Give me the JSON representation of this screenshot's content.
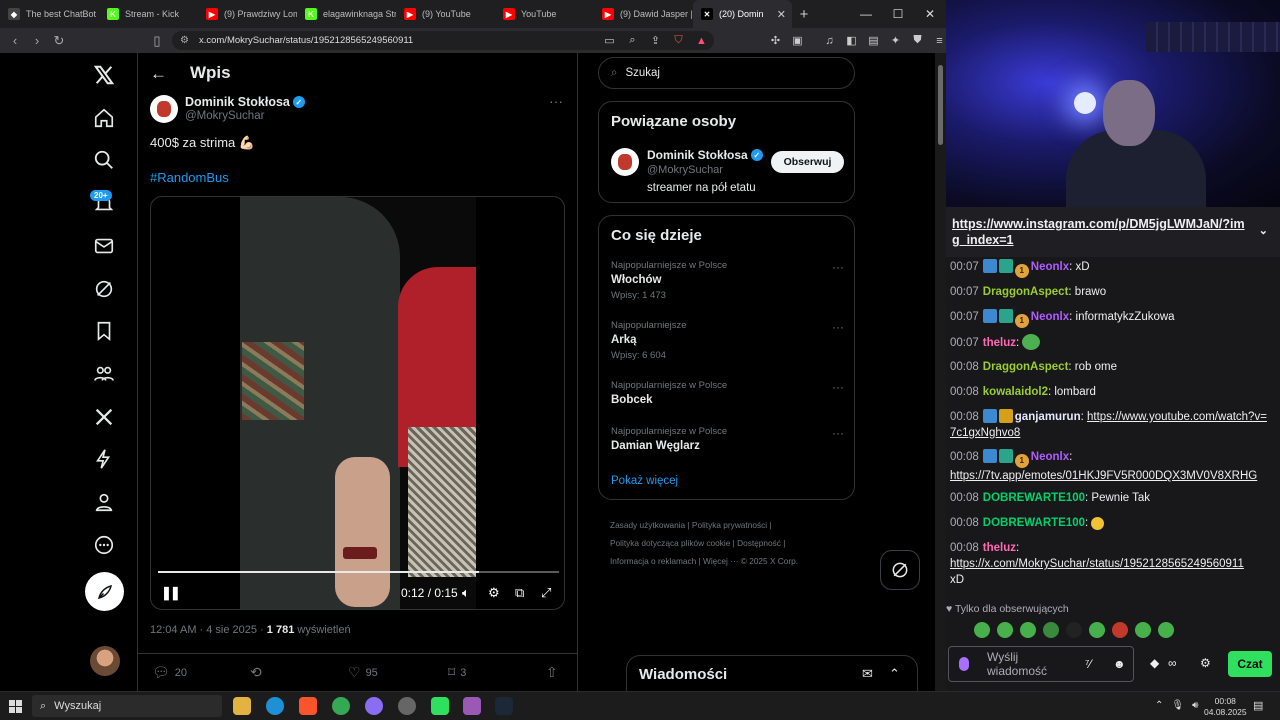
{
  "browser": {
    "tabs": [
      {
        "label": "The best ChatBot",
        "icon": "chatbot-icon",
        "color": "#444444"
      },
      {
        "label": "Stream - Kick",
        "icon": "kick-icon",
        "color": "#53fc18"
      },
      {
        "label": "(9) Prawdziwy Lom",
        "icon": "youtube-icon",
        "color": "#ff0000"
      },
      {
        "label": "elagawinknaga Str",
        "icon": "kick-icon",
        "color": "#53fc18"
      },
      {
        "label": "(9) YouTube",
        "icon": "youtube-icon",
        "color": "#ff0000"
      },
      {
        "label": "YouTube",
        "icon": "youtube-icon",
        "color": "#ff0000"
      },
      {
        "label": "(9) Dawid Jasper |",
        "icon": "youtube-icon",
        "color": "#ff0000"
      },
      {
        "label": "(20) Domin",
        "icon": "x-icon",
        "color": "#000000",
        "active": true
      }
    ],
    "url": "x.com/MokrySuchar/status/1952128565249560911"
  },
  "x": {
    "nav_badge": "20+",
    "page_title": "Wpis",
    "post": {
      "author_name": "Dominik Stokłosa",
      "author_handle": "@MokrySuchar",
      "text": "400$ za strima 💪🏻",
      "hashtag": "#RandomBus",
      "video_time": "0:12 / 0:15",
      "progress": 0.8,
      "meta_time": "12:04 AM · 4 sie 2025 · ",
      "views_count": "1 781",
      "views_label": " wyświetleń",
      "replies": "20",
      "likes": "95",
      "bookmarks": "3"
    },
    "search_placeholder": "Szukaj",
    "related": {
      "title": "Powiązane osoby",
      "name": "Dominik Stokłosa",
      "handle": "@MokrySuchar",
      "bio": "streamer na pół etatu",
      "follow_label": "Obserwuj"
    },
    "trends": {
      "title": "Co się dzieje",
      "items": [
        {
          "category": "Najpopularniejsze w Polsce",
          "name": "Włochów",
          "count": "Wpisy: 1 473"
        },
        {
          "category": "Najpopularniejsze",
          "name": "Arką",
          "count": "Wpisy: 6 604"
        },
        {
          "category": "Najpopularniejsze w Polsce",
          "name": "Bobcek",
          "count": ""
        },
        {
          "category": "Najpopularniejsze w Polsce",
          "name": "Damian Węglarz",
          "count": ""
        }
      ],
      "show_more": "Pokaż więcej"
    },
    "footer": {
      "l1": "Zasady użytkowania   |   Polityka prywatności   |",
      "l2": "Polityka dotycząca plików cookie   |   Dostępność   |",
      "l3": "Informacja o reklamach   |   Więcej ···   © 2025 X Corp."
    },
    "messages_title": "Wiadomości"
  },
  "chat": {
    "pinned_link": "https://www.instagram.com/p/DM5jgLWMJaN/?img_index=1",
    "messages": [
      {
        "time": "00:07",
        "user": "Neonlx",
        "color": "#b05cff",
        "text": ": xD"
      },
      {
        "time": "00:07",
        "user": "DraggonAspect",
        "color": "#9acd32",
        "text": ": brawo"
      },
      {
        "time": "00:07",
        "user": "Neonlx",
        "color": "#b05cff",
        "text": ": informatykzZukowa"
      },
      {
        "time": "00:07",
        "user": "theluz",
        "color": "#ff69b4",
        "text": ":"
      },
      {
        "time": "00:08",
        "user": "DraggonAspect",
        "color": "#9acd32",
        "text": ": rob ome"
      },
      {
        "time": "00:08",
        "user": "kowalaidol2",
        "color": "#9acd32",
        "text": ": lombard"
      },
      {
        "time": "00:08",
        "user": "ganjamurun",
        "color": "#e8e8ff",
        "text": ": ",
        "link": "https://www.youtube.com/watch?v=7c1gxNghvo8"
      },
      {
        "time": "00:08",
        "user": "Neonlx",
        "color": "#b05cff",
        "text": ":",
        "link": "https://7tv.app/emotes/01HKJ9FV5R000DQX3MV0V8XRHG"
      },
      {
        "time": "00:08",
        "user": "DOBREWARTE100",
        "color": "#00d16a",
        "text": ": Pewnie Tak"
      },
      {
        "time": "00:08",
        "user": "DOBREWARTE100",
        "color": "#00d16a",
        "text": ":"
      },
      {
        "time": "00:08",
        "user": "theluz",
        "color": "#ff69b4",
        "text": ":",
        "link": "https://x.com/MokrySuchar/status/1952128565249560911",
        "tail": "xD"
      }
    ],
    "followers_only": "Tylko dla obserwujących",
    "input_placeholder": "Wyślij wiadomość",
    "send_label": "Czat"
  },
  "taskbar": {
    "search": "Wyszukaj",
    "time": "00:08",
    "date": "04.08.2025"
  }
}
